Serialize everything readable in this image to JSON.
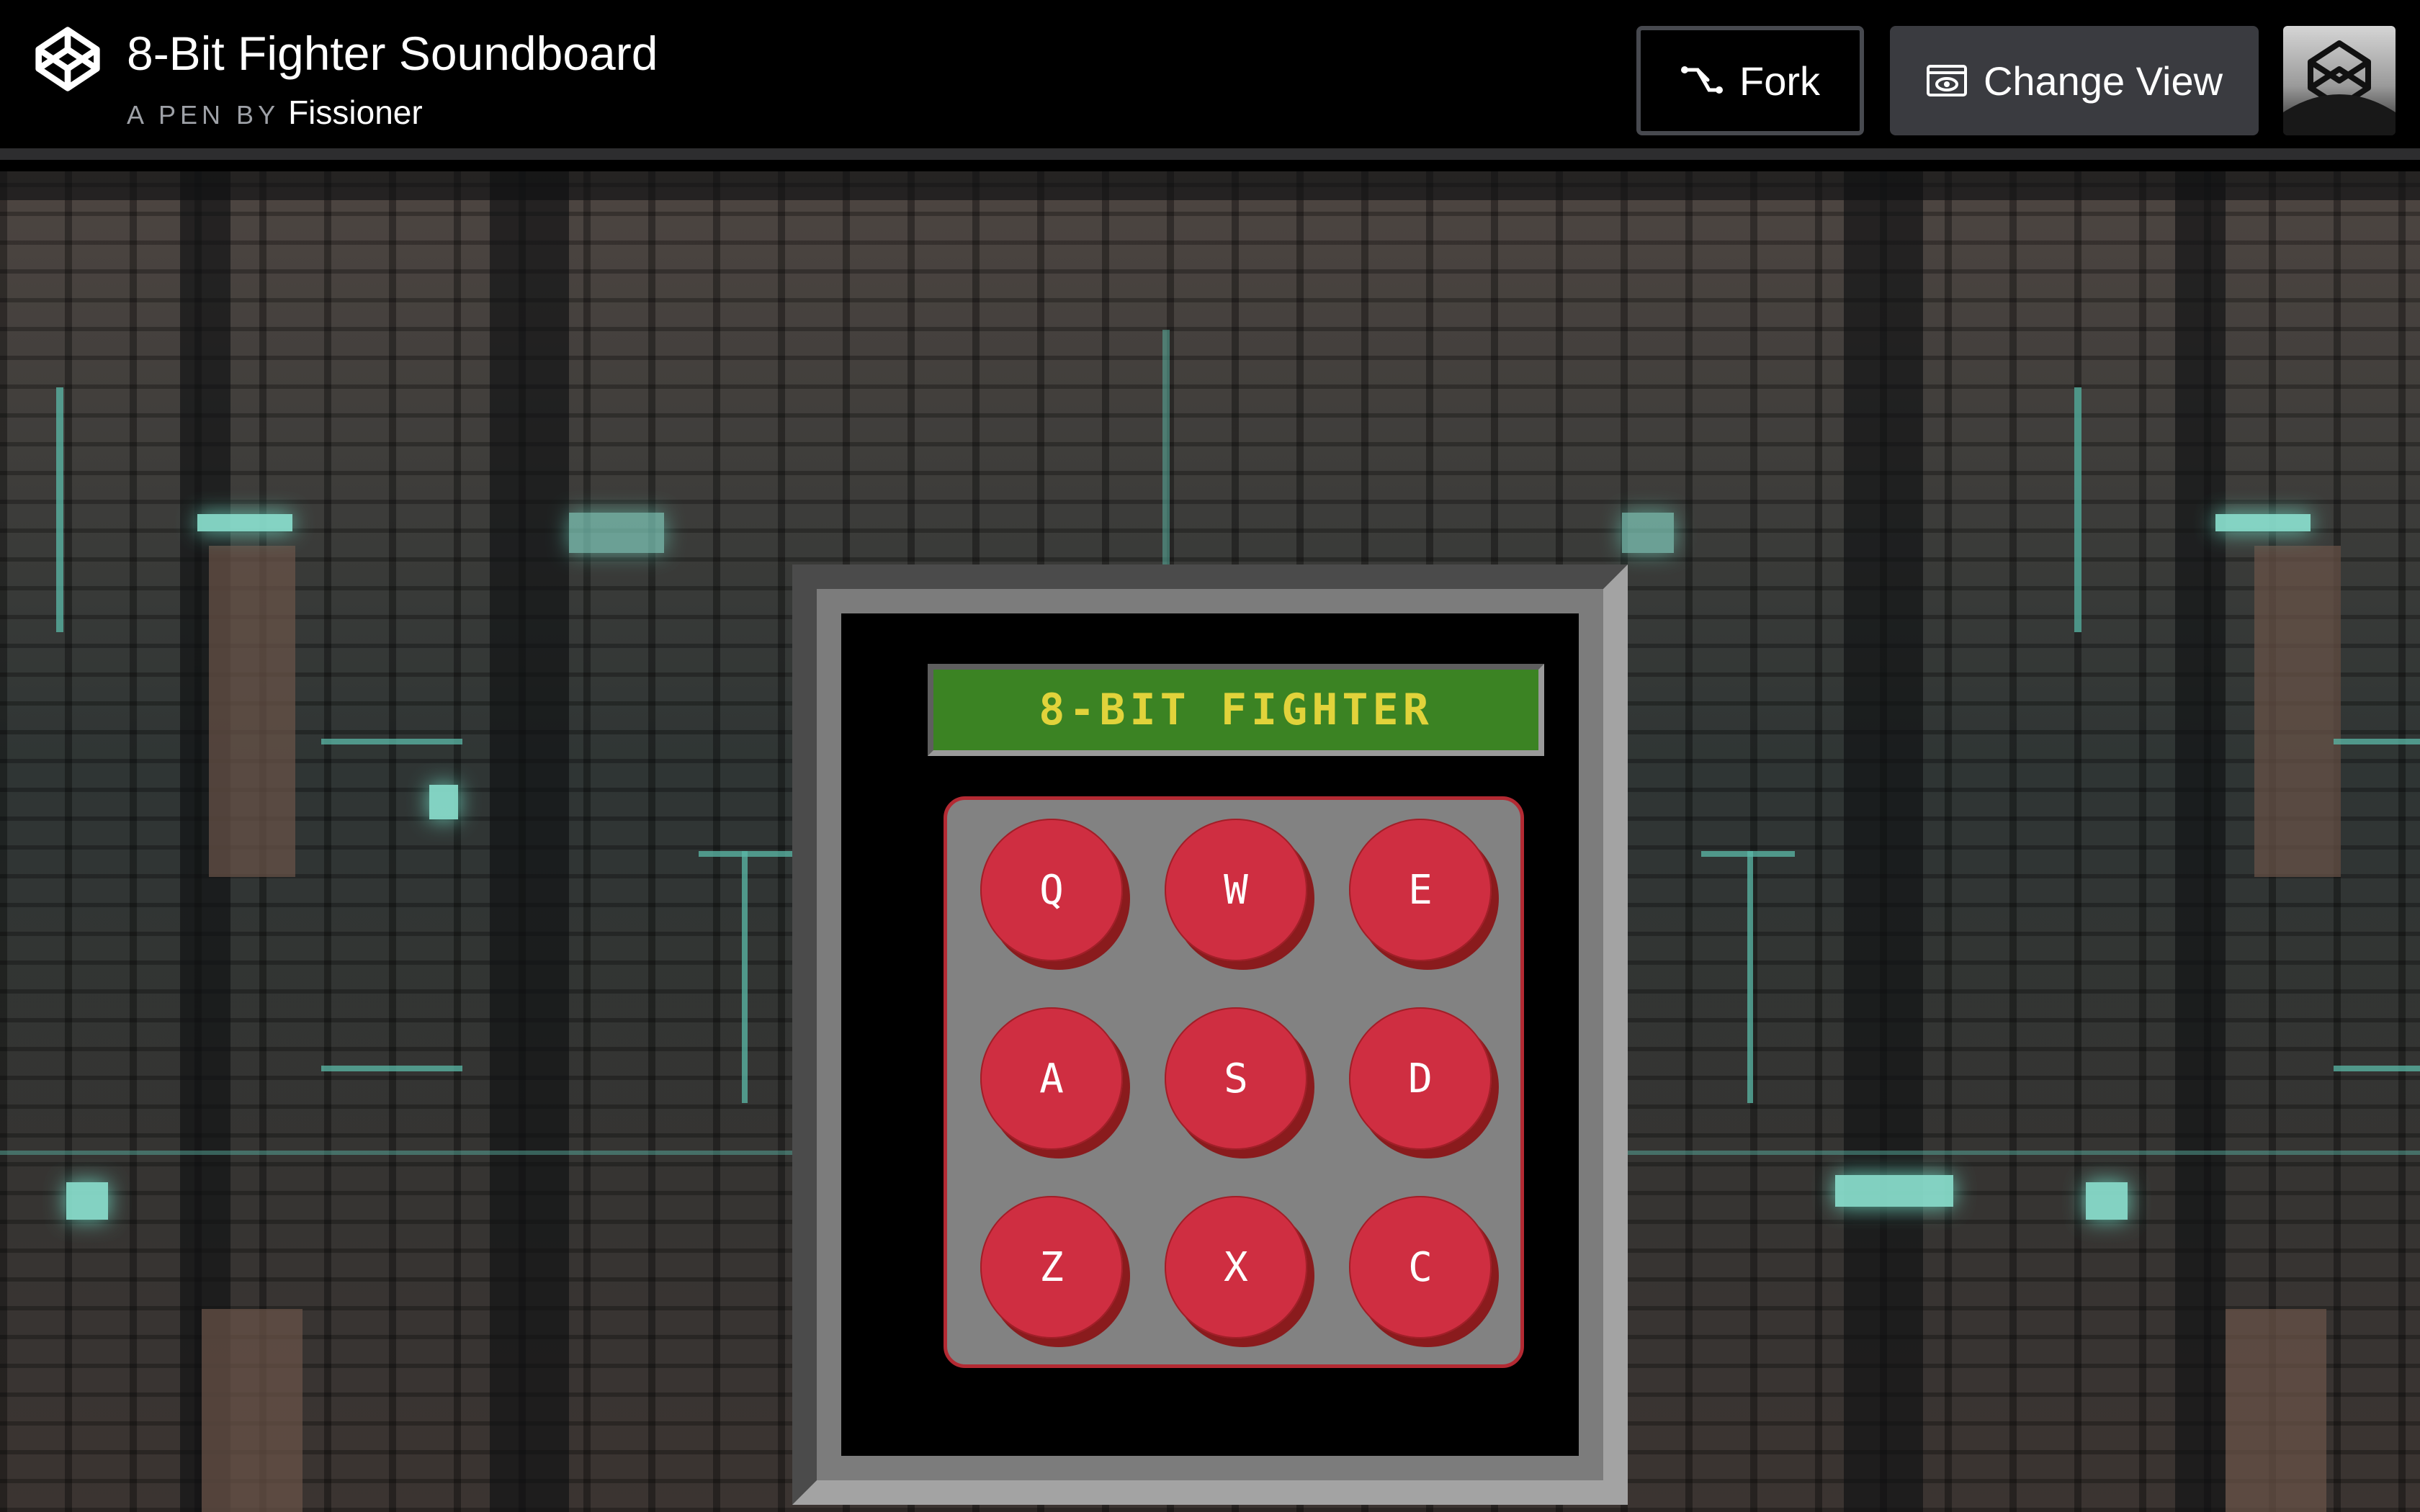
{
  "header": {
    "title": "8-Bit Fighter Soundboard",
    "byline_prefix": "A PEN BY",
    "author": "Fissioner"
  },
  "actions": {
    "fork_label": "Fork",
    "change_view_label": "Change View"
  },
  "icons": {
    "logo": "codepen-logo-icon",
    "fork": "fork-icon",
    "change_view": "eye-window-icon",
    "avatar": "user-avatar-icon"
  },
  "soundboard": {
    "display_text": "8-BIT FIGHTER",
    "keys": [
      "Q",
      "W",
      "E",
      "A",
      "S",
      "D",
      "Z",
      "X",
      "C"
    ]
  },
  "colors": {
    "display_bg": "#3b8323",
    "display_text": "#e1d33b",
    "key_red": "#cf2e41",
    "key_shadow": "#8a1b1d",
    "pad_border": "#b42a33",
    "glow_teal": "#8ce4d2"
  }
}
